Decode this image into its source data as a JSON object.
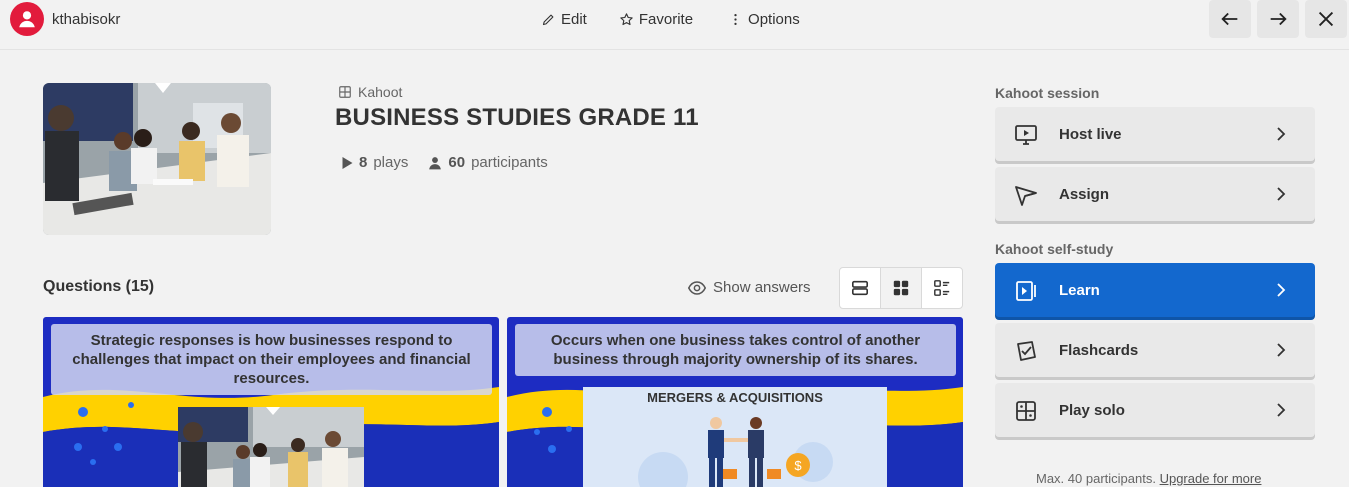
{
  "topbar": {
    "username": "kthabisokr",
    "actions": [
      {
        "label": "Edit",
        "icon": "pencil-icon"
      },
      {
        "label": "Favorite",
        "icon": "star-icon"
      },
      {
        "label": "Options",
        "icon": "kebab-icon"
      }
    ],
    "nav": [
      "arrow-left-icon",
      "arrow-right-icon",
      "close-icon"
    ]
  },
  "kahoot": {
    "type_label": "Kahoot",
    "title": "BUSINESS STUDIES GRADE 11",
    "plays_count": "8",
    "plays_label": "plays",
    "participants_count": "60",
    "participants_label": "participants"
  },
  "questions": {
    "heading": "Questions (15)",
    "show_answers": "Show answers",
    "cards": [
      {
        "text": "Strategic responses is how businesses respond to challenges that impact on their employees and financial resources."
      },
      {
        "text": "Occurs when one business takes control of another business through majority ownership of its shares.",
        "image_caption": "MERGERS & ACQUISITIONS"
      }
    ]
  },
  "side": {
    "session_heading": "Kahoot session",
    "session_buttons": [
      {
        "label": "Host live",
        "icon": "present-icon"
      },
      {
        "label": "Assign",
        "icon": "send-icon"
      }
    ],
    "selfstudy_heading": "Kahoot self-study",
    "selfstudy_buttons": [
      {
        "label": "Learn",
        "icon": "learn-play-icon"
      },
      {
        "label": "Flashcards",
        "icon": "flashcards-icon"
      },
      {
        "label": "Play solo",
        "icon": "grid-icon"
      }
    ],
    "max_note": "Max. 40 participants.",
    "upgrade_link": "Upgrade for more"
  },
  "colors": {
    "brand_red": "#e21b3c",
    "primary_blue": "#1368ce",
    "card_blue": "#1d2cc2",
    "card_yellow": "#ffd100"
  }
}
